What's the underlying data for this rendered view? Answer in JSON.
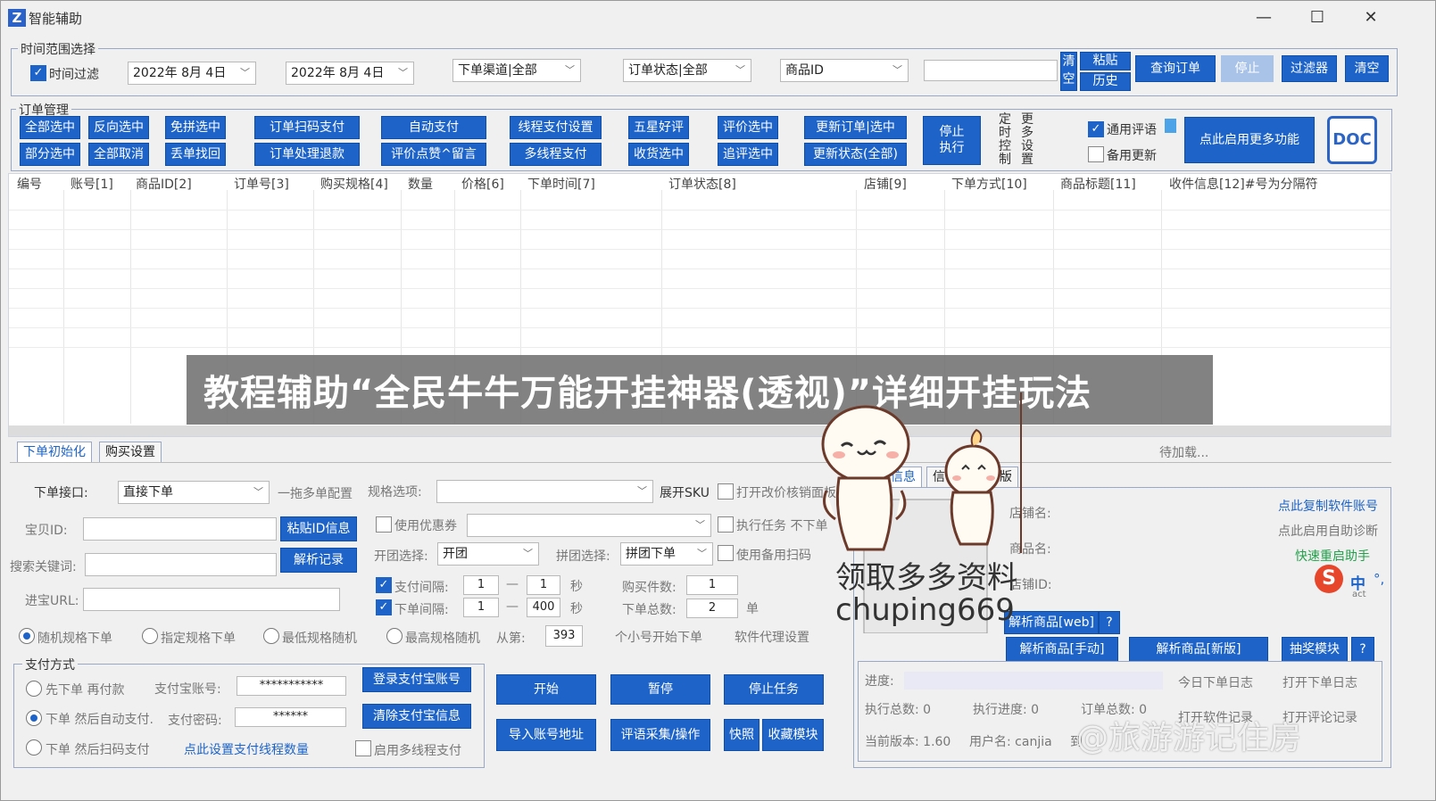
{
  "app": {
    "icon_letter": "Z",
    "title": "智能辅助"
  },
  "window_controls": {
    "minimize": "—",
    "maximize": "☐",
    "close": "✕"
  },
  "time_range": {
    "group_title": "时间范围选择",
    "time_filter_label": "时间过滤",
    "start_date": "2022年 8月 4日",
    "end_date": "2022年 8月 4日",
    "channel": "下单渠道|全部",
    "order_status": "订单状态|全部",
    "field": "商品ID",
    "search_value": "",
    "clear_label": "清空",
    "paste_label": "粘贴",
    "history_label": "历史",
    "query_label": "查询订单",
    "stop_label": "停止",
    "filter_label": "过滤器",
    "clear2_label": "清空"
  },
  "order_mgmt": {
    "group_title": "订单管理",
    "row1": [
      "全部选中",
      "反向选中",
      "免拼选中",
      "订单扫码支付",
      "自动支付",
      "线程支付设置",
      "五星好评",
      "评价选中",
      "更新订单|选中"
    ],
    "row2": [
      "部分选中",
      "全部取消",
      "丢单找回",
      "订单处理退款",
      "评价点赞^留言",
      "多线程支付",
      "收货选中",
      "追评选中",
      "更新状态(全部)"
    ],
    "stop_exec": "停止\n执行",
    "timer_ctrl": "定时控制",
    "more_settings": "更多设置",
    "general_review": "通用评语",
    "backup_update": "备用更新",
    "enable_more": "点此启用更多功能",
    "doc": "DOC"
  },
  "table": {
    "columns": [
      "编号",
      "账号[1]",
      "商品ID[2]",
      "订单号[3]",
      "购买规格[4]",
      "数量",
      "价格[6]",
      "下单时间[7]",
      "订单状态[8]",
      "店铺[9]",
      "下单方式[10]",
      "商品标题[11]",
      "收件信息[12]#号为分隔符"
    ]
  },
  "overlay": {
    "headline": "教程辅助“全民牛牛万能开挂神器(透视)”详细开挂玩法"
  },
  "tabs": {
    "tab1": "下单初始化",
    "tab2": "购买设置",
    "loading": "待加载...",
    "info_tab": "信息",
    "info_tab2": "信",
    "info_tab3": "版"
  },
  "order_init": {
    "interface_label": "下单接口:",
    "interface_value": "直接下单",
    "multi_config": "一拖多单配置",
    "spec_label": "规格选项:",
    "spec_value": "",
    "expand_sku": "展开SKU",
    "open_price_page": "打开改价核销面板",
    "item_id_label": "宝贝ID:",
    "item_id_value": "",
    "paste_id": "粘贴ID信息",
    "use_coupon": "使用优惠券",
    "coupon_value": "",
    "exec_task": "执行任务 不下单",
    "keyword_label": "搜索关键词:",
    "keyword_value": "",
    "parse_record": "解析记录",
    "group_label": "开团选择:",
    "group_value": "开团",
    "pin_label": "拼团选择:",
    "pin_value": "拼团下单",
    "backup_scan": "使用备用扫码",
    "shop_url_label": "进宝URL:",
    "shop_url_value": "",
    "pay_interval": "支付间隔:",
    "pay_min": "1",
    "pay_max": "1",
    "sec": "秒",
    "dash": "—",
    "order_interval": "下单间隔:",
    "order_min": "1",
    "order_max": "400",
    "sec2": "秒",
    "buy_count_label": "购买件数:",
    "buy_count": "1",
    "order_total_label": "下单总数:",
    "order_total": "2",
    "unit": "单",
    "radio_random": "随机规格下单",
    "radio_specified": "指定规格下单",
    "radio_lowest": "最低规格随机",
    "radio_highest": "最高规格随机",
    "from_label": "从第:",
    "from_value": "393",
    "small_start": "个小号开始下单",
    "proxy_settings": "软件代理设置"
  },
  "payment": {
    "group_title": "支付方式",
    "opt1": "先下单 再付款",
    "opt2": "下单 然后自动支付.",
    "opt3": "下单 然后扫码支付",
    "alipay_account_label": "支付宝账号:",
    "alipay_account": "***********",
    "alipay_pwd_label": "支付密码:",
    "alipay_pwd": "******",
    "login_alipay": "登录支付宝账号",
    "clear_alipay": "清除支付宝信息",
    "set_threads": "点此设置支付线程数量",
    "multi_thread_pay": "启用多线程支付"
  },
  "actions": {
    "start": "开始",
    "pause": "暂停",
    "stop_task": "停止任务",
    "import_addr": "导入账号地址",
    "review_collect": "评语采集/操作",
    "quick": "快照",
    "favorites": "收藏模块"
  },
  "right_panel": {
    "shop_name": "店铺名:",
    "copy_account": "点此复制软件账号",
    "product_name": "商品名:",
    "self_diagnose": "点此启用自助诊断",
    "restart_helper": "快速重启助手",
    "shop_id": "店铺ID:",
    "parse_web": "解析商品[web]",
    "help": "?",
    "parse_manual": "解析商品[手动]",
    "parse_new": "解析商品[新版]",
    "lottery": "抽奖模块",
    "help2": "?",
    "progress_label": "进度:",
    "today_log": "今日下单日志",
    "open_log": "打开下单日志",
    "exec_total": "执行总数: 0",
    "exec_progress": "执行进度: 0",
    "order_total": "订单总数: 0",
    "open_software": "打开软件记录",
    "open_review": "打开评论记录",
    "version": "当前版本: 1.60",
    "username": "用户名: canjia",
    "expire": "到"
  },
  "ime": {
    "logo": "S",
    "lang": "中",
    "punct": "°,",
    "act": "act"
  },
  "promo": {
    "line1": "领取多多资料",
    "line2": "chuping669"
  },
  "watermark": "@旅游游记住房",
  "colors": {
    "accent": "#1e64c8",
    "overlay": "#6e6e6e"
  }
}
